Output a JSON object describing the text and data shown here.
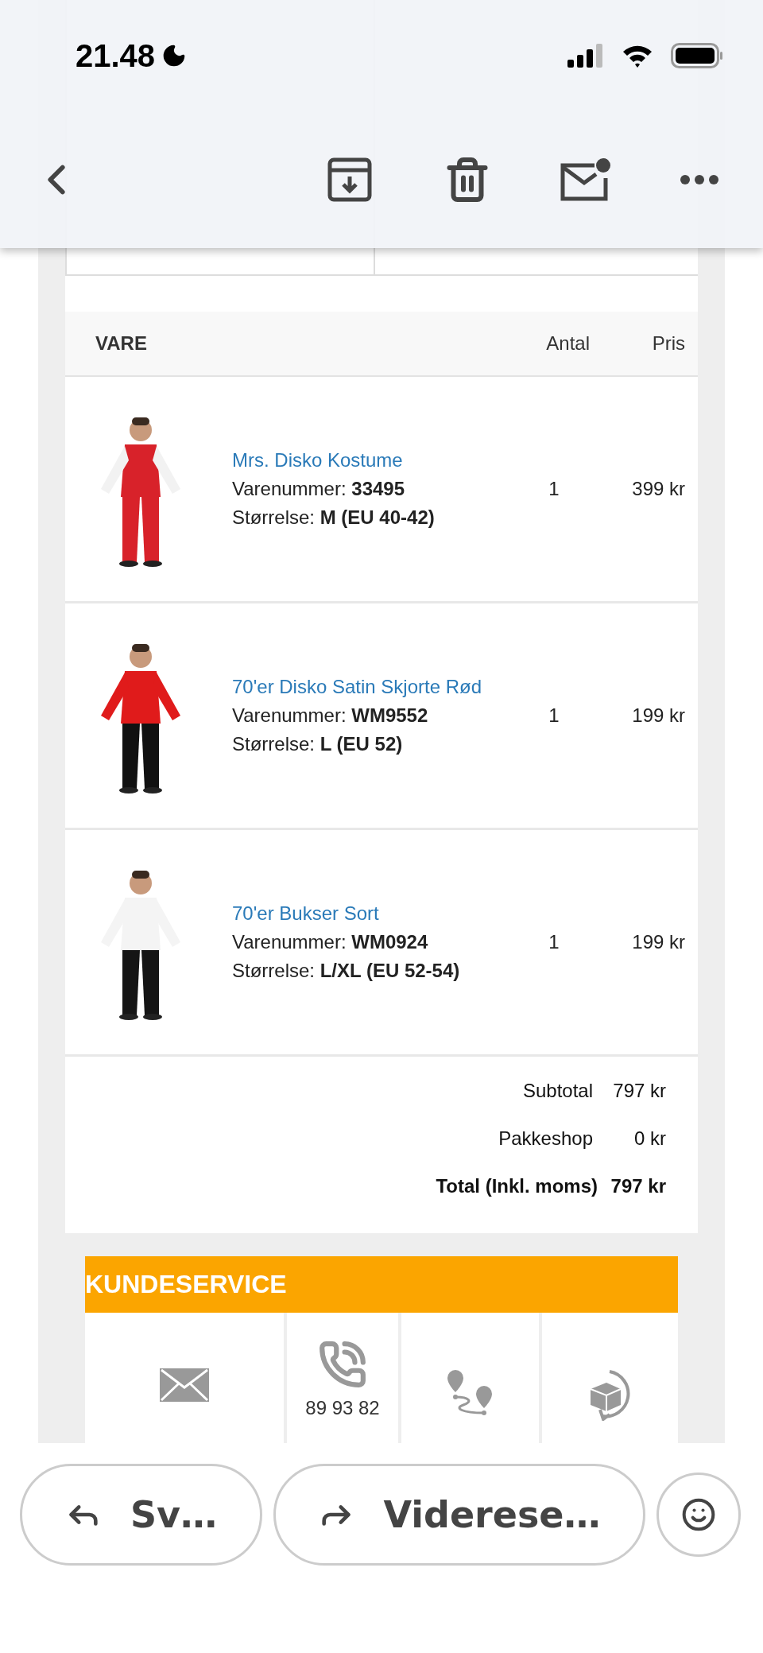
{
  "status_bar": {
    "time": "21.48"
  },
  "items_table": {
    "columns": [
      "VARE",
      "Antal",
      "Pris"
    ],
    "rows": [
      {
        "name": "Mrs. Disko Kostume",
        "sku_label": "Varenummer:",
        "sku": "33495",
        "size_label": "Størrelse:",
        "size": "M (EU 40-42)",
        "quantity": "1",
        "price": "399 kr"
      },
      {
        "name": "70'er Disko Satin Skjorte Rød",
        "sku_label": "Varenummer:",
        "sku": "WM9552",
        "size_label": "Størrelse:",
        "size": "L (EU 52)",
        "quantity": "1",
        "price": "199 kr"
      },
      {
        "name": "70'er Bukser Sort",
        "sku_label": "Varenummer:",
        "sku": "WM0924",
        "size_label": "Størrelse:",
        "size": "L/XL (EU 52-54)",
        "quantity": "1",
        "price": "199 kr"
      }
    ]
  },
  "totals": [
    {
      "label": "Subtotal",
      "value": "797 kr",
      "bold": false
    },
    {
      "label": "Pakkeshop",
      "value": "0 kr",
      "bold": false
    },
    {
      "label": "Total (Inkl. moms)",
      "value": "797 kr",
      "bold": true
    }
  ],
  "customer_service": {
    "title": "KUNDESERVICE",
    "cells": [
      {
        "kind": "email"
      },
      {
        "kind": "phone",
        "text": "89 93 82"
      },
      {
        "kind": "route"
      },
      {
        "kind": "returns"
      }
    ]
  },
  "actions": [
    {
      "kind": "reply",
      "label": "Sv…"
    },
    {
      "kind": "forward",
      "label": "Viderese…"
    },
    {
      "kind": "emoji"
    }
  ]
}
